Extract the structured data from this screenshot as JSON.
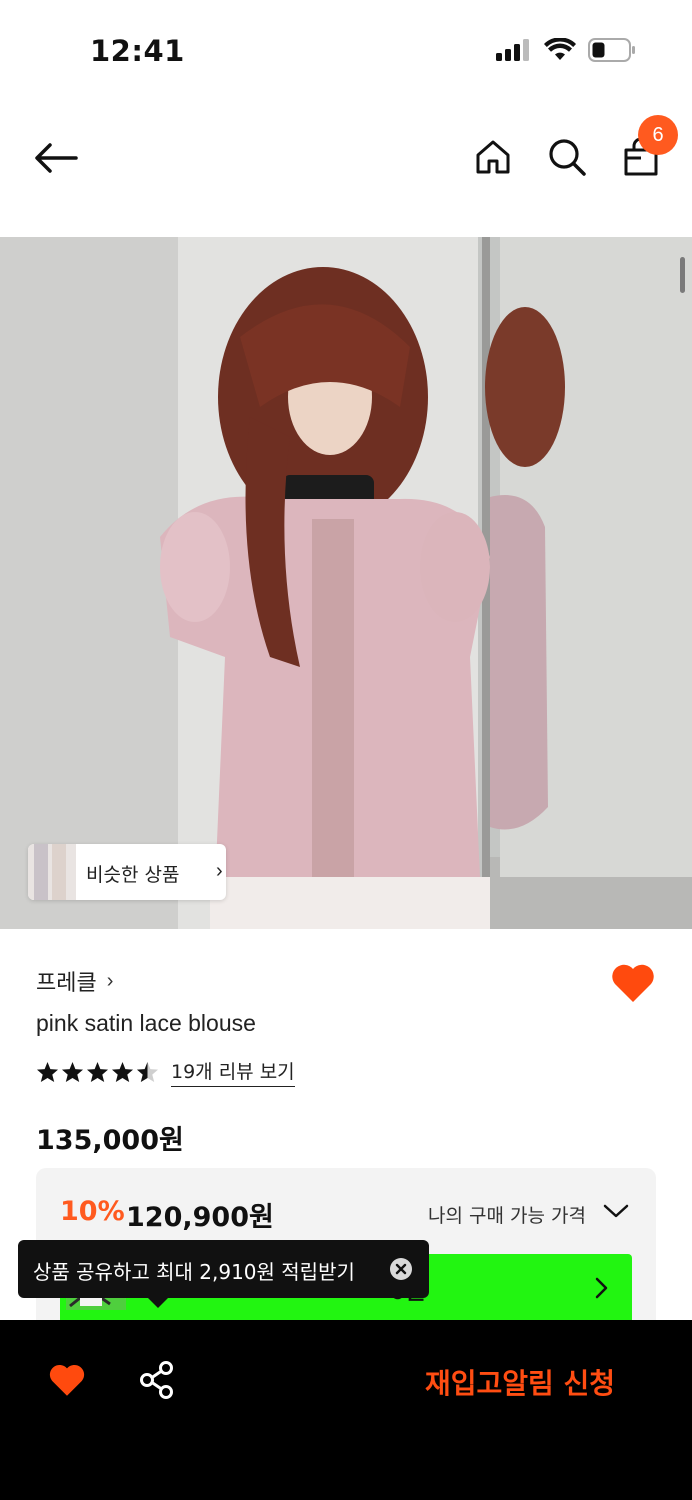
{
  "status_bar": {
    "time": "12:41",
    "icons": [
      "cellular-signal-icon",
      "wifi-icon",
      "battery-icon"
    ]
  },
  "nav": {
    "back_icon": "arrow-left-icon",
    "home_icon": "home-icon",
    "search_icon": "search-icon",
    "bag_icon": "shopping-bag-icon",
    "bag_count": "6"
  },
  "product": {
    "image_alt": "model wearing pink satin lace blouse",
    "similar_label": "비슷한 상품",
    "brand": "프레클",
    "name": "pink satin lace blouse",
    "rating": 4.5,
    "review_link": "19개 리뷰 보기",
    "original_price": "135,000원",
    "discount_percent": "10%",
    "discount_price": "120,900원",
    "my_price_label": "나의 구매 가능 가격",
    "banner_price_visible": "0원"
  },
  "tooltip": {
    "text": "상품 공유하고 최대 2,910원 적립받기"
  },
  "bottom_bar": {
    "restock_label": "재입고알림 신청"
  },
  "colors": {
    "accent": "#ff5a1f",
    "restock": "#ff4d12",
    "banner_green": "#22f511",
    "heart": "#ff4a0e"
  }
}
